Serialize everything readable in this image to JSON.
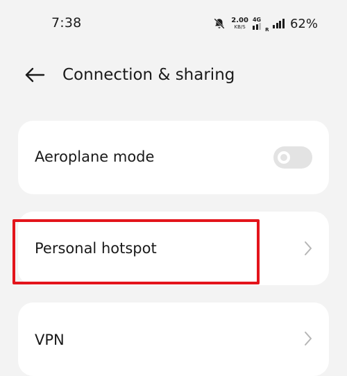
{
  "status_bar": {
    "time": "7:38",
    "speed_value": "2.00",
    "speed_unit": "KB/S",
    "network_type": "4G",
    "roaming": "R",
    "battery": "62%"
  },
  "header": {
    "title": "Connection & sharing",
    "back_icon": "back-arrow-icon"
  },
  "settings": {
    "aeroplane_mode": {
      "label": "Aeroplane mode",
      "enabled": false
    },
    "personal_hotspot": {
      "label": "Personal hotspot"
    },
    "vpn": {
      "label": "VPN"
    }
  },
  "colors": {
    "background": "#f3f3f3",
    "card": "#ffffff",
    "toggle_off": "#e3e3e3",
    "highlight": "#e3141b",
    "chevron": "#b5b5b5"
  }
}
